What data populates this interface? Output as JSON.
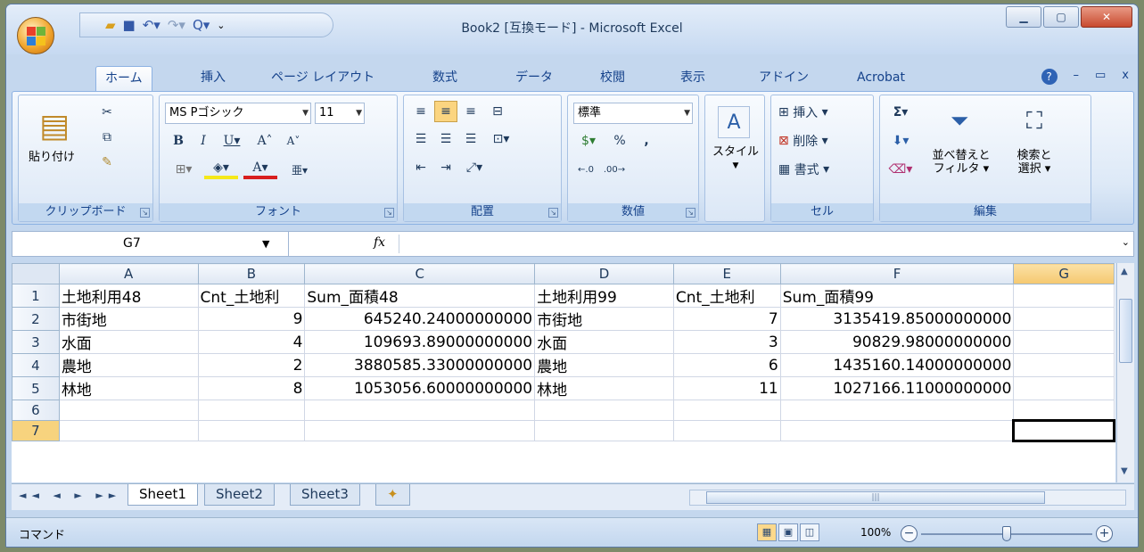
{
  "window": {
    "title": "Book2 [互換モード] - Microsoft Excel"
  },
  "ribbon_tabs": [
    "ホーム",
    "挿入",
    "ページ レイアウト",
    "数式",
    "データ",
    "校閲",
    "表示",
    "アドイン",
    "Acrobat"
  ],
  "ribbon": {
    "clipboard": {
      "label": "クリップボード",
      "paste": "貼り付け"
    },
    "font": {
      "label": "フォント",
      "font_name": "MS Pゴシック",
      "font_size": "11"
    },
    "alignment": {
      "label": "配置"
    },
    "number": {
      "label": "数値",
      "format": "標準"
    },
    "styles": {
      "label": "スタイル"
    },
    "cells": {
      "label": "セル",
      "insert": "挿入",
      "delete": "削除",
      "format": "書式"
    },
    "editing": {
      "label": "編集",
      "sort": "並べ替えと",
      "sort2": "フィルタ",
      "find": "検索と",
      "find2": "選択"
    }
  },
  "formula_bar": {
    "name_box": "G7",
    "fx": "fx",
    "content": ""
  },
  "columns": [
    "A",
    "B",
    "C",
    "D",
    "E",
    "F",
    "G"
  ],
  "rows": [
    {
      "num": "1",
      "cells": [
        "土地利用48",
        "Cnt_土地利",
        "Sum_面積48",
        "土地利用99",
        "Cnt_土地利",
        "Sum_面積99",
        ""
      ]
    },
    {
      "num": "2",
      "cells": [
        "市街地",
        "9",
        "645240.24000000000",
        "市街地",
        "7",
        "3135419.85000000000",
        ""
      ]
    },
    {
      "num": "3",
      "cells": [
        "水面",
        "4",
        "109693.89000000000",
        "水面",
        "3",
        "90829.98000000000",
        ""
      ]
    },
    {
      "num": "4",
      "cells": [
        "農地",
        "2",
        "3880585.33000000000",
        "農地",
        "6",
        "1435160.14000000000",
        ""
      ]
    },
    {
      "num": "5",
      "cells": [
        "林地",
        "8",
        "1053056.60000000000",
        "林地",
        "11",
        "1027166.11000000000",
        ""
      ]
    },
    {
      "num": "6",
      "cells": [
        "",
        "",
        "",
        "",
        "",
        "",
        ""
      ]
    },
    {
      "num": "7",
      "cells": [
        "",
        "",
        "",
        "",
        "",
        "",
        ""
      ]
    }
  ],
  "sheets": [
    "Sheet1",
    "Sheet2",
    "Sheet3"
  ],
  "status": {
    "mode": "コマンド",
    "zoom": "100%"
  }
}
